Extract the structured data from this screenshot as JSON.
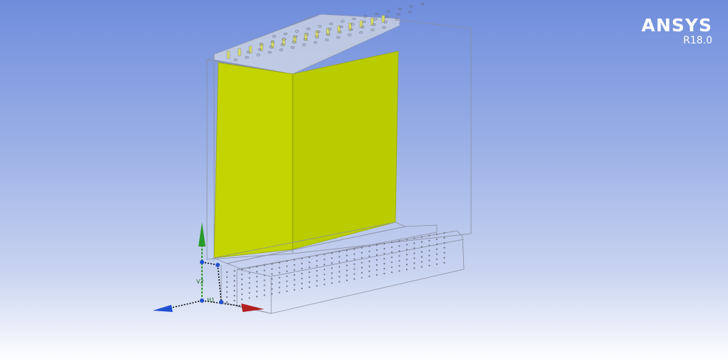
{
  "brand": {
    "name": "ANSYS",
    "version": "R18.0"
  },
  "triad": {
    "v_label": "V2",
    "h_label": "H1"
  },
  "colors": {
    "background_top": "#6f8ddc",
    "background_bottom": "#ffffff",
    "selected_face": "#c3d400",
    "axis_x": "#b02020",
    "axis_y": "#2a9a2a",
    "axis_z": "#2050d0"
  }
}
